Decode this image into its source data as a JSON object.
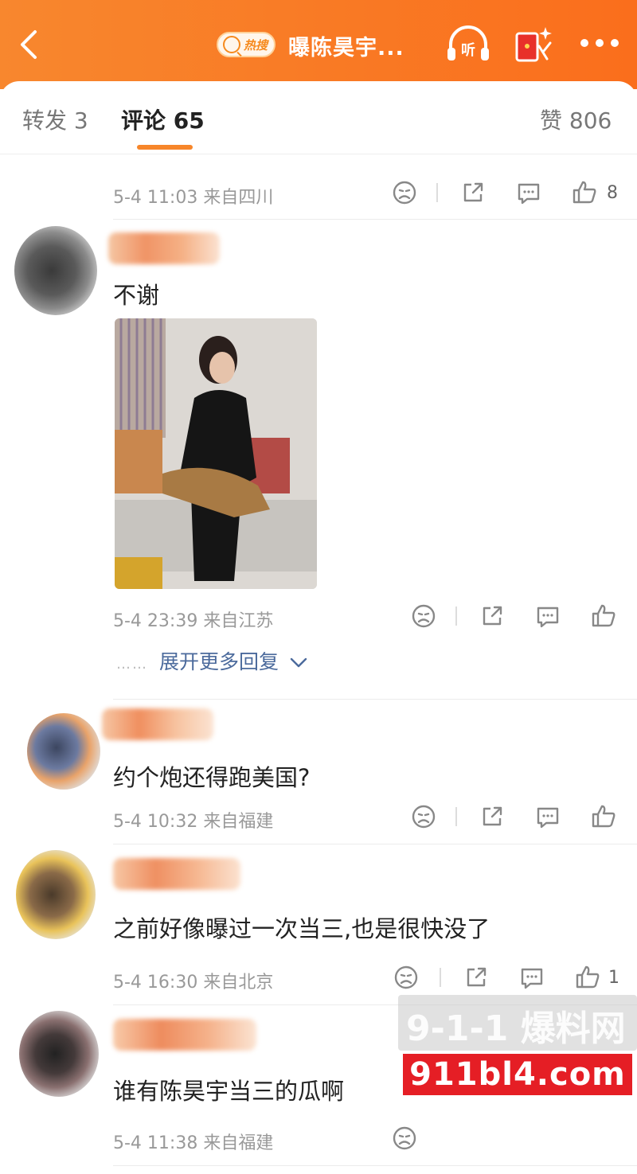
{
  "header": {
    "hot_badge": "热搜",
    "title": "曝陈昊宇...",
    "listen_label": "听"
  },
  "tabs": [
    {
      "label": "转发 3"
    },
    {
      "label": "评论 65"
    },
    {
      "label": "赞 806"
    }
  ],
  "comments": [
    {
      "time": "5-4 11:03 来自四川",
      "likes": "8"
    },
    {
      "text": "不谢",
      "time": "5-4 23:39 来自江苏",
      "likes": "",
      "expand": "展开更多回复",
      "expand_dots": "……"
    },
    {
      "text": "约个炮还得跑美国?",
      "time": "5-4 10:32 来自福建",
      "likes": ""
    },
    {
      "text": "之前好像曝过一次当三,也是很快没了",
      "time": "5-4 16:30 来自北京",
      "likes": "1"
    },
    {
      "text": "谁有陈昊宇当三的瓜啊",
      "time": "5-4 11:38 来自福建",
      "likes": ""
    }
  ],
  "watermark": {
    "top": "9-1-1 爆料网",
    "bottom": "911bl4.com"
  },
  "colors": {
    "header_start": "#f8872e",
    "header_end": "#fa6e1c",
    "tab_indicator": "#f7862a",
    "link": "#4b6a9c",
    "watermark_red": "#e51e25"
  }
}
